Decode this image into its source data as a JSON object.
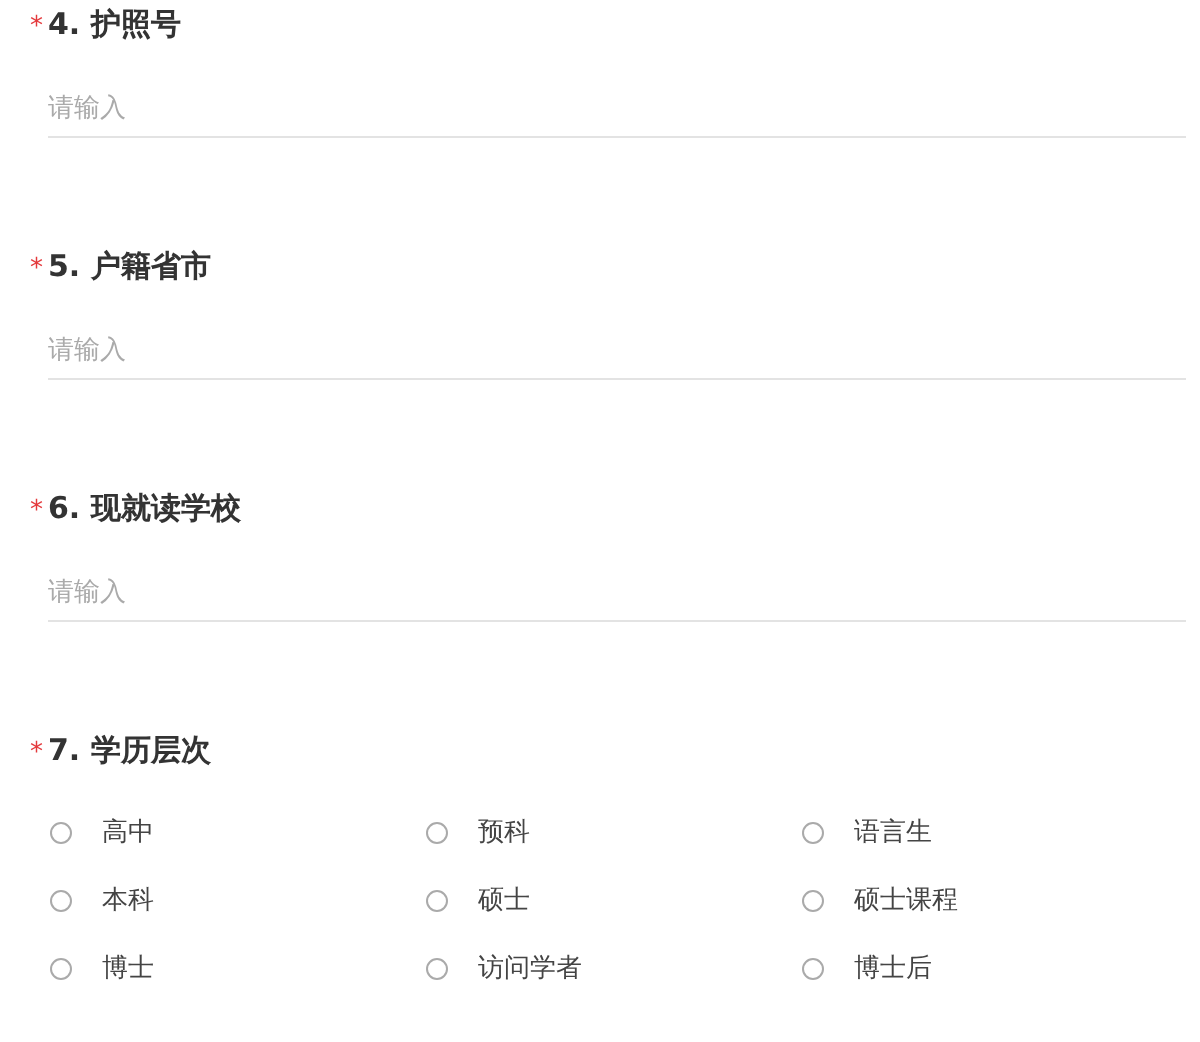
{
  "questions": [
    {
      "kind": "text",
      "required": true,
      "required_mark": "*",
      "number": "4.",
      "title": "护照号",
      "placeholder": "请输入"
    },
    {
      "kind": "text",
      "required": true,
      "required_mark": "*",
      "number": "5.",
      "title": "户籍省市",
      "placeholder": "请输入"
    },
    {
      "kind": "text",
      "required": true,
      "required_mark": "*",
      "number": "6.",
      "title": "现就读学校",
      "placeholder": "请输入"
    },
    {
      "kind": "radio",
      "required": true,
      "required_mark": "*",
      "number": "7.",
      "title": "学历层次",
      "options": [
        {
          "label": "高中",
          "selected": false
        },
        {
          "label": "预科",
          "selected": false
        },
        {
          "label": "语言生",
          "selected": false
        },
        {
          "label": "本科",
          "selected": false
        },
        {
          "label": "硕士",
          "selected": false
        },
        {
          "label": "硕士课程",
          "selected": false
        },
        {
          "label": "博士",
          "selected": false
        },
        {
          "label": "访问学者",
          "selected": false
        },
        {
          "label": "博士后",
          "selected": false
        }
      ]
    }
  ]
}
